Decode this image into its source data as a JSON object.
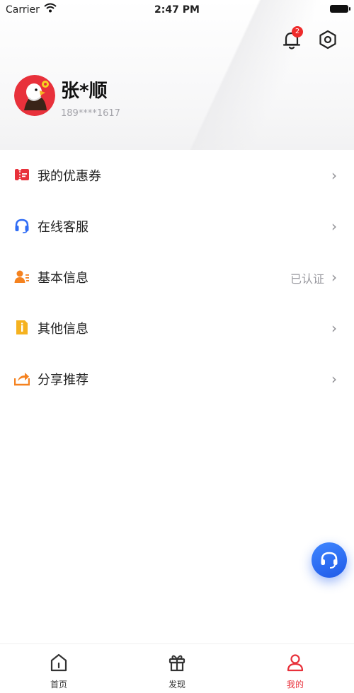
{
  "status_bar": {
    "carrier": "Carrier",
    "time": "2:47 PM"
  },
  "header": {
    "notification_count": "2"
  },
  "profile": {
    "name": "张*顺",
    "phone": "189****1617"
  },
  "menu": {
    "items": [
      {
        "label": "我的优惠券",
        "icon": "coupon-icon",
        "status": ""
      },
      {
        "label": "在线客服",
        "icon": "headset-icon",
        "status": ""
      },
      {
        "label": "基本信息",
        "icon": "user-info-icon",
        "status": "已认证"
      },
      {
        "label": "其他信息",
        "icon": "document-icon",
        "status": ""
      },
      {
        "label": "分享推荐",
        "icon": "share-icon",
        "status": ""
      }
    ]
  },
  "tabbar": {
    "tabs": [
      {
        "label": "首页",
        "icon": "home-icon"
      },
      {
        "label": "发现",
        "icon": "gift-icon"
      },
      {
        "label": "我的",
        "icon": "person-icon"
      }
    ],
    "active_index": 2
  },
  "colors": {
    "accent_red": "#e8313b",
    "blue": "#2f6cf5",
    "orange": "#f5821f",
    "yellow": "#f5b21f"
  }
}
